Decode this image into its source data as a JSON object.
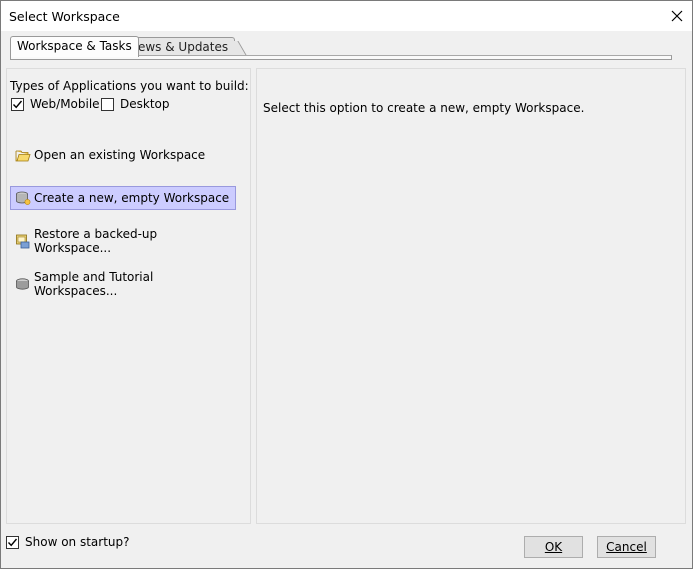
{
  "window": {
    "title": "Select Workspace"
  },
  "tabs": [
    {
      "label": "Workspace & Tasks",
      "active": true
    },
    {
      "label": "News & Updates",
      "active": false
    }
  ],
  "left": {
    "types_label": "Types of Applications you want to build:",
    "checkboxes": [
      {
        "label": "Web/Mobile",
        "checked": true
      },
      {
        "label": "Desktop",
        "checked": false
      }
    ],
    "options": [
      {
        "label": "Open an existing Workspace",
        "icon": "folder-open-icon",
        "selected": false
      },
      {
        "label": "Create a new, empty Workspace",
        "icon": "database-new-icon",
        "selected": true
      },
      {
        "label": "Restore a backed-up Workspace...",
        "icon": "restore-icon",
        "selected": false
      },
      {
        "label": "Sample and Tutorial Workspaces...",
        "icon": "database-icon",
        "selected": false
      }
    ]
  },
  "right": {
    "description": "Select this option to create a new, empty Workspace."
  },
  "footer": {
    "show_on_startup_label": "Show on startup?",
    "show_on_startup_checked": true,
    "ok_label": "OK",
    "cancel_label": "Cancel"
  },
  "colors": {
    "selection_bg": "#ccccff",
    "selection_border": "#9999dd",
    "window_bg": "#f0f0f0"
  }
}
